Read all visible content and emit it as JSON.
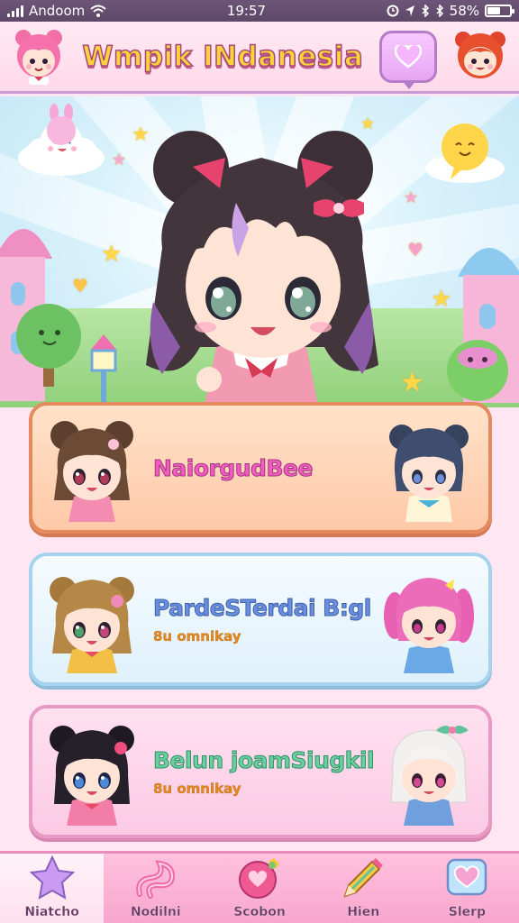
{
  "status_bar": {
    "carrier": "Andoom",
    "time": "19:57",
    "battery": "58%",
    "battery_level": 0.58
  },
  "header": {
    "title": "Wmpik INdanesia"
  },
  "cards": [
    {
      "name": "NaiorgudBee",
      "subtitle": ""
    },
    {
      "name": "PardeSTerdai B:gl",
      "subtitle": "8u omnikay"
    },
    {
      "name": "Belun joamSiugkil",
      "subtitle": "8u omnikay"
    }
  ],
  "nav": [
    {
      "label": "Niatcho",
      "icon": "star-icon"
    },
    {
      "label": "Nodilni",
      "icon": "ribbon-icon"
    },
    {
      "label": "Scobon",
      "icon": "heart-orb-icon"
    },
    {
      "label": "Hien",
      "icon": "pencil-icon"
    },
    {
      "label": "Slerp",
      "icon": "heart-box-icon"
    }
  ],
  "colors": {
    "title_fill": "#ffd23a",
    "accent_pink": "#f25bc0",
    "nav_bg": "#f7a6cd"
  }
}
